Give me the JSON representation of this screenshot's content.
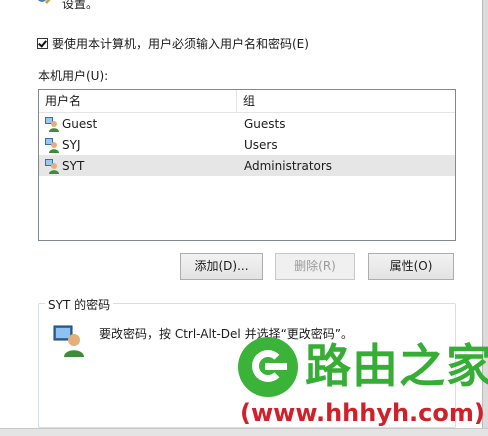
{
  "top_text": "设置。",
  "require_password_checkbox": {
    "label": "要使用本计算机，用户必须输入用户名和密码(E)",
    "checked": true
  },
  "users_list": {
    "label": "本机用户(U):",
    "columns": [
      "用户名",
      "组"
    ],
    "rows": [
      {
        "user": "Guest",
        "group": "Guests",
        "selected": false
      },
      {
        "user": "SYJ",
        "group": "Users",
        "selected": false
      },
      {
        "user": "SYT",
        "group": "Administrators",
        "selected": true
      }
    ]
  },
  "buttons": {
    "add": "添加(D)...",
    "remove": "删除(R)",
    "properties": "属性(O)"
  },
  "password_group": {
    "title": "SYT 的密码",
    "text": "要改密码，按 Ctrl-Alt-Del 并选择“更改密码”。"
  },
  "watermark": {
    "name": "路由之家",
    "url": "(www.hhhyh.com)",
    "color_green": "#36ad35",
    "color_red": "#d0202a"
  }
}
